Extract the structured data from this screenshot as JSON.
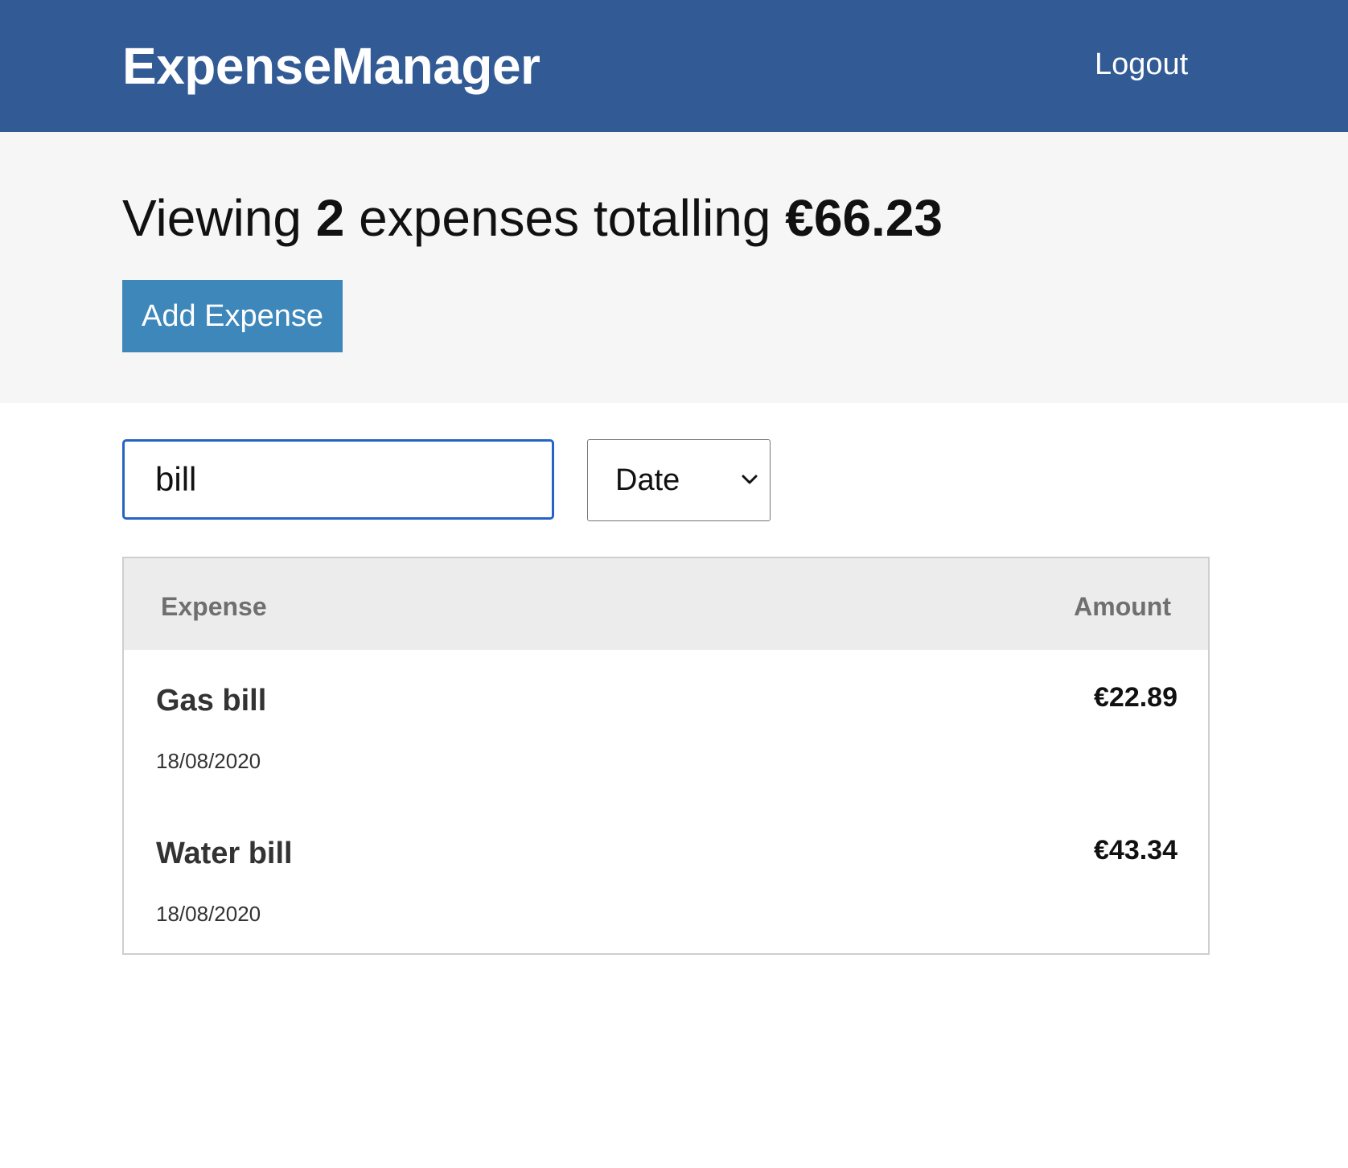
{
  "header": {
    "brand": "ExpenseManager",
    "logout_label": "Logout",
    "background_color": "#325b96"
  },
  "summary": {
    "prefix": "Viewing",
    "count": "2",
    "middle": "expenses totalling",
    "total": "€66.23",
    "add_button_label": "Add Expense",
    "add_button_color": "#3d87bb"
  },
  "filters": {
    "search_value": "bill",
    "sort_selected": "Date"
  },
  "table": {
    "headers": {
      "expense": "Expense",
      "amount": "Amount"
    },
    "rows": [
      {
        "name": "Gas bill",
        "date": "18/08/2020",
        "amount": "€22.89"
      },
      {
        "name": "Water bill",
        "date": "18/08/2020",
        "amount": "€43.34"
      }
    ]
  }
}
